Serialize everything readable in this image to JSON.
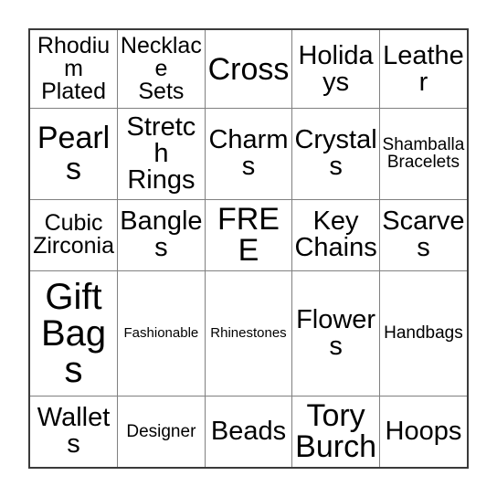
{
  "card": {
    "type": "bingo-card",
    "columns": 5,
    "rows": 5,
    "free_space": "FREE",
    "free_space_position": {
      "row": 3,
      "column": 3
    },
    "colors": {
      "background": "#ffffff",
      "outer_border": "#3a3a3a",
      "grid_line": "#808080",
      "text": "#000000"
    },
    "cells": [
      [
        {
          "label": "Rhodium\nPlated",
          "size": "md"
        },
        {
          "label": "Necklace\nSets",
          "size": "md"
        },
        {
          "label": "Cross",
          "size": "xl"
        },
        {
          "label": "Holidays",
          "size": "lg"
        },
        {
          "label": "Leather",
          "size": "lg"
        }
      ],
      [
        {
          "label": "Pearls",
          "size": "xl"
        },
        {
          "label": "Stretch\nRings",
          "size": "lg"
        },
        {
          "label": "Charms",
          "size": "lg"
        },
        {
          "label": "Crystals",
          "size": "lg"
        },
        {
          "label": "Shamballa\nBracelets",
          "size": "sm"
        }
      ],
      [
        {
          "label": "Cubic\nZirconia",
          "size": "md"
        },
        {
          "label": "Bangles",
          "size": "lg"
        },
        {
          "label": "FREE",
          "size": "xl"
        },
        {
          "label": "Key\nChains",
          "size": "lg"
        },
        {
          "label": "Scarves",
          "size": "lg"
        }
      ],
      [
        {
          "label": "Gift\nBags",
          "size": "xxl"
        },
        {
          "label": "Fashionable",
          "size": "xs"
        },
        {
          "label": "Rhinestones",
          "size": "xs"
        },
        {
          "label": "Flowers",
          "size": "lg"
        },
        {
          "label": "Handbags",
          "size": "sm"
        }
      ],
      [
        {
          "label": "Wallets",
          "size": "lg"
        },
        {
          "label": "Designer",
          "size": "sm"
        },
        {
          "label": "Beads",
          "size": "lg"
        },
        {
          "label": "Tory\nBurch",
          "size": "xl"
        },
        {
          "label": "Hoops",
          "size": "lg"
        }
      ]
    ]
  }
}
